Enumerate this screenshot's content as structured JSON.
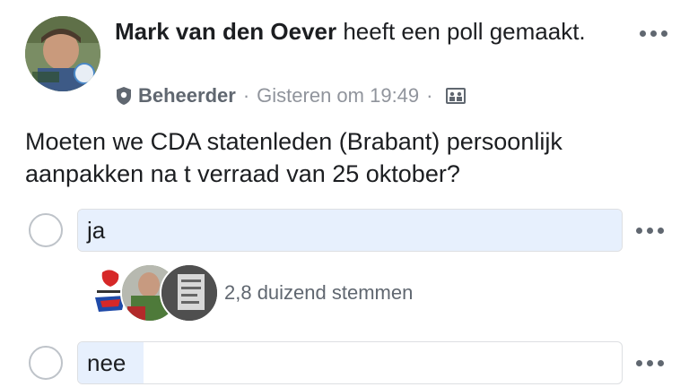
{
  "post": {
    "author_name": "Mark van den Oever",
    "action_text": " heeft een poll gemaakt.",
    "role": "Beheerder",
    "timestamp": "Gisteren om 19:49",
    "separator": "·"
  },
  "poll": {
    "question": "Moeten we CDA statenleden (Brabant) persoonlijk aanpakken na t verraad van 25 oktober?",
    "options": [
      {
        "label": "ja",
        "vote_text": "2,8 duizend stemmen",
        "share": 1.0
      },
      {
        "label": "nee",
        "share": 0.12
      }
    ]
  },
  "colors": {
    "poll_fill": "#e7f0fd",
    "text_primary": "#1c1e21",
    "text_secondary": "#90949c"
  },
  "icons": {
    "more": "more-dots-icon",
    "admin": "shield-icon",
    "group": "group-icon"
  }
}
